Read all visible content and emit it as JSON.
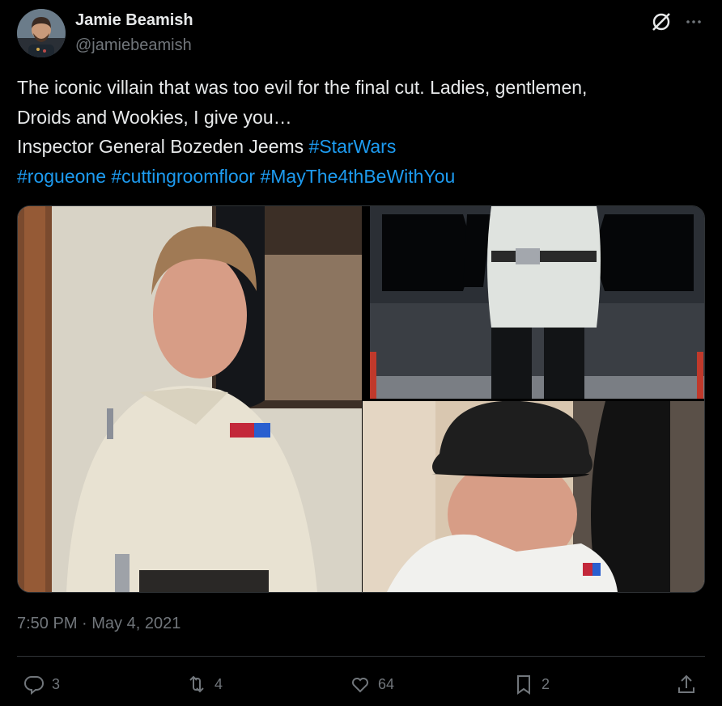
{
  "author": {
    "name": "Jamie Beamish",
    "handle": "@jamiebeamish",
    "avatar_icon": "user-avatar"
  },
  "header_icons": [
    "grok-icon",
    "more-icon"
  ],
  "tweet": {
    "lines": [
      [
        {
          "text": "The iconic villain that was too evil for the final cut. Ladies, gentlemen,",
          "tag": false
        }
      ],
      [
        {
          "text": "Droids and Wookies, I give you…",
          "tag": false
        }
      ],
      [
        {
          "text": "Inspector General Bozeden Jeems ",
          "tag": false
        },
        {
          "text": "#StarWars",
          "tag": true
        }
      ],
      [
        {
          "text": "#rogueone",
          "tag": true
        },
        {
          "text": " ",
          "tag": false
        },
        {
          "text": "#cuttingroomfloor",
          "tag": true
        },
        {
          "text": " ",
          "tag": false
        },
        {
          "text": "#MayThe4thBeWithYou",
          "tag": true
        }
      ]
    ],
    "link_color": "#1d9bf0"
  },
  "media": {
    "photos": [
      {
        "id": "photo-uniform-portrait"
      },
      {
        "id": "photo-starship-bridge"
      },
      {
        "id": "photo-officer-cap-selfie"
      }
    ]
  },
  "timestamp": "7:50 PM · May 4, 2021",
  "actions": {
    "reply": {
      "icon": "reply-icon",
      "count": "3"
    },
    "repost": {
      "icon": "repost-icon",
      "count": "4"
    },
    "like": {
      "icon": "like-icon",
      "count": "64"
    },
    "bookmark": {
      "icon": "bookmark-icon",
      "count": "2"
    },
    "share": {
      "icon": "share-icon"
    }
  },
  "colors": {
    "background": "#000000",
    "text": "#e7e9ea",
    "muted": "#71767b",
    "accent": "#1d9bf0",
    "divider": "#2f3336"
  }
}
